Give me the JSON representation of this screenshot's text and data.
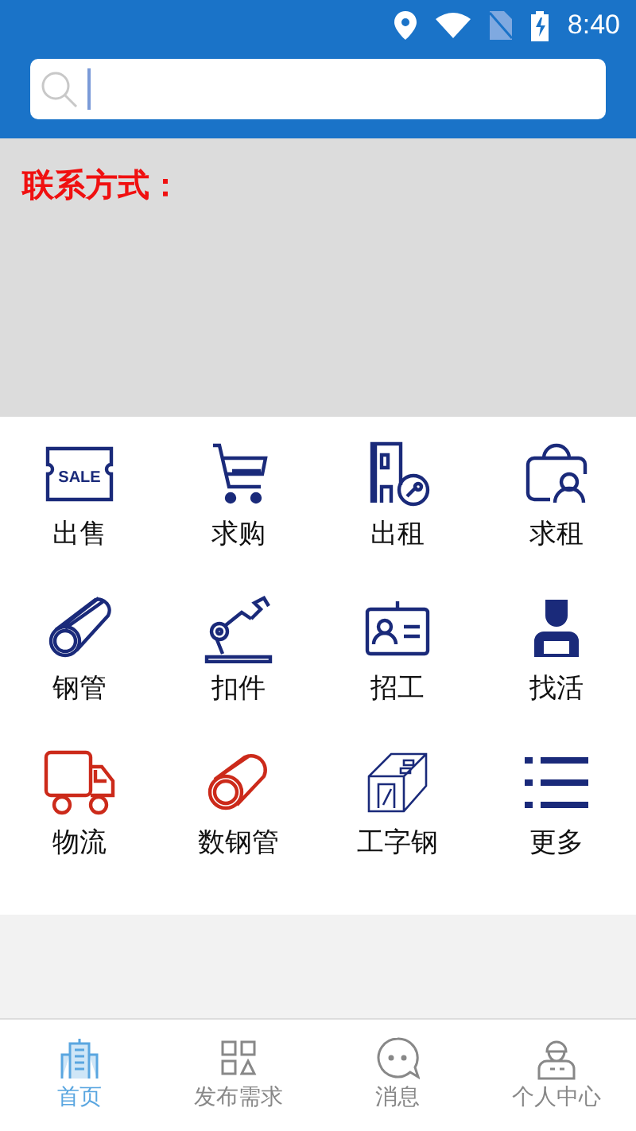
{
  "status_bar": {
    "time": "8:40"
  },
  "banner": {
    "title": "联系方式："
  },
  "categories": [
    {
      "label": "出售",
      "icon_text": "SALE",
      "color": "#1a2a7a"
    },
    {
      "label": "求购",
      "color": "#1a2a7a"
    },
    {
      "label": "出租",
      "color": "#1a2a7a"
    },
    {
      "label": "求租",
      "color": "#1a2a7a"
    },
    {
      "label": "钢管",
      "color": "#1a2a7a"
    },
    {
      "label": "扣件",
      "color": "#1a2a7a"
    },
    {
      "label": "招工",
      "color": "#1a2a7a"
    },
    {
      "label": "找活",
      "color": "#1a2a7a"
    },
    {
      "label": "物流",
      "color": "#cc2a1a"
    },
    {
      "label": "数钢管",
      "color": "#cc2a1a"
    },
    {
      "label": "工字钢",
      "color": "#1a2a7a"
    },
    {
      "label": "更多",
      "color": "#1a2a7a"
    }
  ],
  "tabs": [
    {
      "label": "首页",
      "selected": true
    },
    {
      "label": "发布需求",
      "selected": false
    },
    {
      "label": "消息",
      "selected": false
    },
    {
      "label": "个人中心",
      "selected": false
    }
  ]
}
